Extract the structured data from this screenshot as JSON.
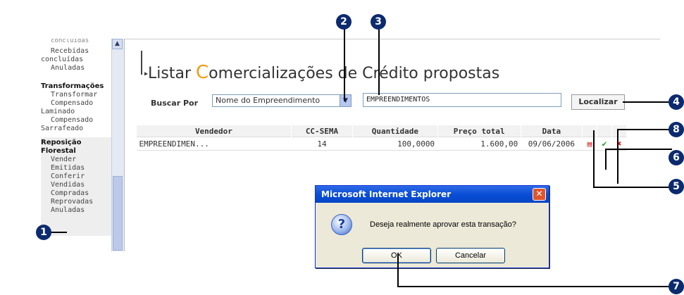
{
  "sidebar": {
    "top_cut_label": "concluidas",
    "items": [
      {
        "label": "Recebidas",
        "indent": true
      },
      {
        "label": "concluídas",
        "indent": false
      },
      {
        "label": "Anuladas",
        "indent": true
      }
    ],
    "section_transformacoes": {
      "header": "Transformações",
      "items": [
        {
          "label": "Transformar",
          "indent": true
        },
        {
          "label": "Compensado",
          "indent": true
        },
        {
          "label": "Laminado",
          "indent": false
        },
        {
          "label": "Compensado",
          "indent": true
        },
        {
          "label": "Sarrafeado",
          "indent": false
        }
      ]
    },
    "section_reposicao": {
      "header_line1": "Reposição",
      "header_line2": "Florestal",
      "items": [
        "Vender",
        "Emitidas",
        "Conferir",
        "Vendidas",
        "Compradas",
        "Reprovadas",
        "Anuladas"
      ]
    }
  },
  "page": {
    "title_prefix": "Listar ",
    "title_big_letter": "C",
    "title_rest": "omercializações de Crédito propostas"
  },
  "search": {
    "label": "Buscar Por",
    "select_value": "Nome do Empreendimento",
    "input_value": "EMPREENDIMENTOS",
    "button_label": "Localizar"
  },
  "table": {
    "headers": [
      "Vendedor",
      "CC-SEMA",
      "Quantidade",
      "Preço total",
      "Data"
    ],
    "rows": [
      {
        "vendedor": "EMPREENDIMEN...",
        "cc_sema": "14",
        "quantidade": "100,0000",
        "preco_total": "1.600,00",
        "data": "09/06/2006"
      }
    ]
  },
  "dialog": {
    "title": "Microsoft Internet Explorer",
    "message": "Deseja realmente aprovar esta transação?",
    "ok_label": "OK",
    "cancel_label": "Cancelar",
    "icon": "question-icon"
  },
  "callouts": [
    "1",
    "2",
    "3",
    "4",
    "5",
    "6",
    "7",
    "8"
  ],
  "colors": {
    "accent_orange": "#f29c12",
    "callout_navy": "#0c2a6e",
    "xp_title_blue": "#0a4ed6"
  }
}
